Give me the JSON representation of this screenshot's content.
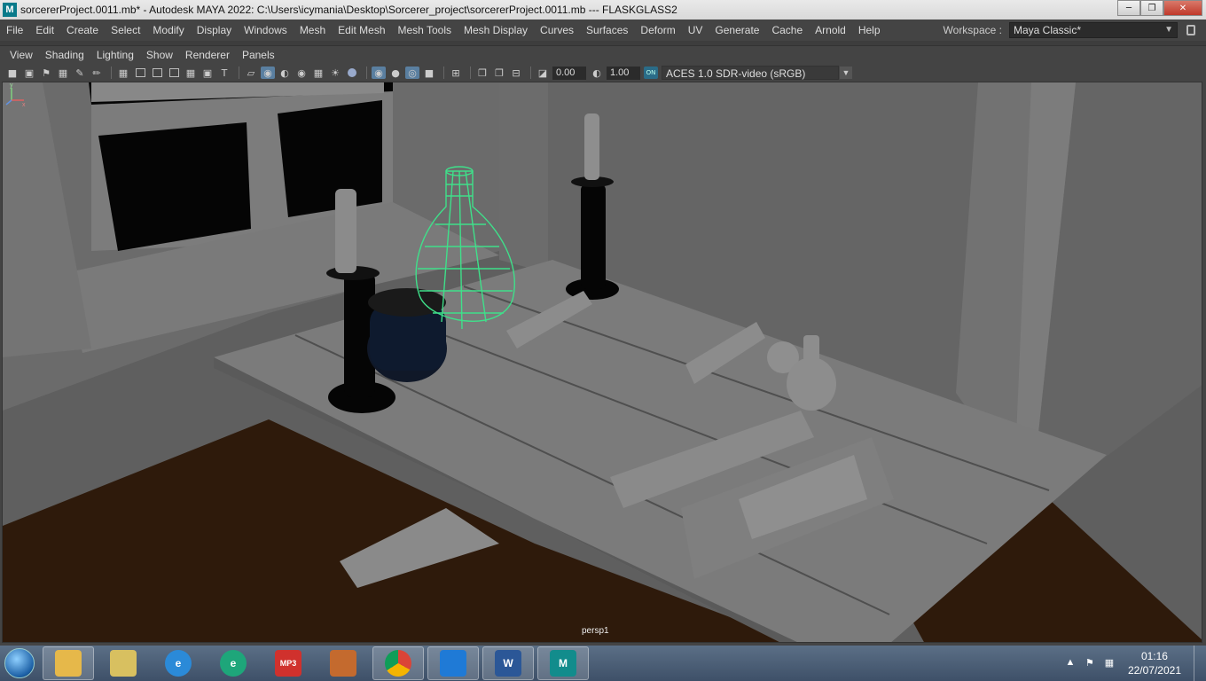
{
  "window": {
    "title": "sorcererProject.0011.mb* - Autodesk MAYA 2022: C:\\Users\\icymania\\Desktop\\Sorcerer_project\\sorcererProject.0011.mb   ---   FLASKGLASS2",
    "app_icon": "M"
  },
  "menubar": {
    "items": [
      "File",
      "Edit",
      "Create",
      "Select",
      "Modify",
      "Display",
      "Windows",
      "Mesh",
      "Edit Mesh",
      "Mesh Tools",
      "Mesh Display",
      "Curves",
      "Surfaces",
      "Deform",
      "UV",
      "Generate",
      "Cache",
      "Arnold",
      "Help"
    ],
    "workspace_label": "Workspace :",
    "workspace_value": "Maya Classic*"
  },
  "panel_menu": {
    "items": [
      "View",
      "Shading",
      "Lighting",
      "Show",
      "Renderer",
      "Panels"
    ]
  },
  "panel_toolbar": {
    "exposure": "0.00",
    "gamma": "1.00",
    "colorspace": "ACES 1.0 SDR-video (sRGB)"
  },
  "viewport": {
    "camera": "persp1",
    "axis_y": "y",
    "axis_x": "x",
    "selected_object": "FLASKGLASS2",
    "selection_color": "#3fe08a",
    "floor_color": "#2e1a0b"
  },
  "taskbar": {
    "apps": [
      {
        "name": "windows-explorer",
        "label": ""
      },
      {
        "name": "paint",
        "label": ""
      },
      {
        "name": "internet-explorer",
        "label": "e"
      },
      {
        "name": "edge",
        "label": "e"
      },
      {
        "name": "mp3",
        "label": "MP3"
      },
      {
        "name": "toolbox",
        "label": ""
      },
      {
        "name": "chrome",
        "label": ""
      },
      {
        "name": "vscode",
        "label": ""
      },
      {
        "name": "word",
        "label": "W"
      },
      {
        "name": "maya",
        "label": "M"
      }
    ],
    "time": "01:16",
    "date": "22/07/2021"
  }
}
